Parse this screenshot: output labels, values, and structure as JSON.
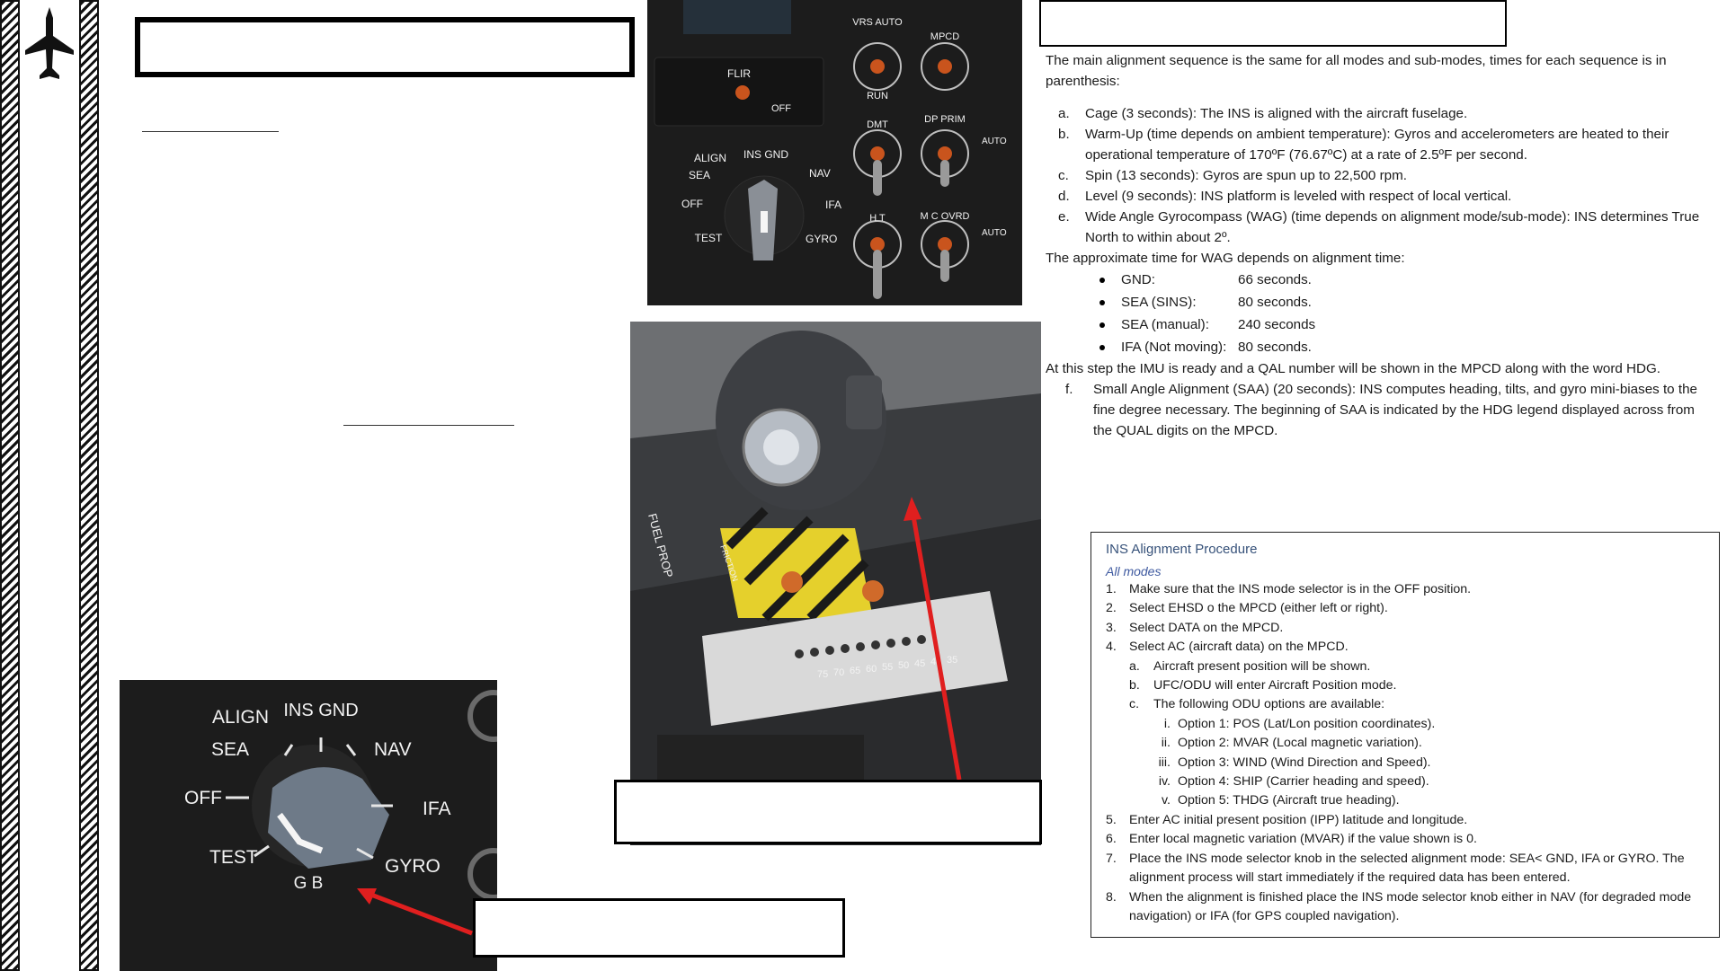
{
  "intro": "The main alignment sequence is the same for all modes and sub-modes, times for each sequence is in parenthesis:",
  "steps": [
    {
      "marker": "a.",
      "text": "Cage (3 seconds): The INS is aligned with the aircraft fuselage."
    },
    {
      "marker": "b.",
      "text": "Warm-Up (time depends on ambient temperature): Gyros and accelerometers are heated to their operational temperature of 170ºF (76.67ºC) at a rate of 2.5ºF per second."
    },
    {
      "marker": "c.",
      "text": "Spin (13 seconds): Gyros are spun up to 22,500 rpm."
    },
    {
      "marker": "d.",
      "text": "Level (9 seconds): INS platform is leveled with respect of local vertical."
    },
    {
      "marker": "e.",
      "text": "Wide Angle Gyrocompass (WAG) (time depends on alignment mode/sub-mode): INS determines True North to within about 2º."
    }
  ],
  "wag_note": "The approximate time for WAG depends on alignment time:",
  "wag_times": [
    {
      "mode": "GND:",
      "time": "66 seconds."
    },
    {
      "mode": "SEA (SINS):",
      "time": "80 seconds."
    },
    {
      "mode": "SEA (manual):",
      "time": "240 seconds"
    },
    {
      "mode": "IFA (Not moving):",
      "time": "80 seconds."
    }
  ],
  "ready_note": "At this step the IMU is ready and a QAL number will be shown in the MPCD along with the word HDG.",
  "step_f": {
    "marker": "f.",
    "text": "Small Angle Alignment (SAA) (20 seconds): INS computes heading, tilts, and gyro mini-biases to the fine degree necessary. The beginning of SAA is indicated by the HDG legend displayed across from the QUAL digits on the MPCD."
  },
  "procedure": {
    "title": "INS Alignment Procedure",
    "subtitle": "All modes",
    "items": [
      {
        "level": 1,
        "marker": "1.",
        "text": "Make sure that the INS mode selector is in the OFF position."
      },
      {
        "level": 1,
        "marker": "2.",
        "text": "Select EHSD o the MPCD (either left or right)."
      },
      {
        "level": 1,
        "marker": "3.",
        "text": "Select DATA on the MPCD."
      },
      {
        "level": 1,
        "marker": "4.",
        "text": "Select AC (aircraft data) on the MPCD."
      },
      {
        "level": 2,
        "marker": "a.",
        "text": "Aircraft present position will be shown."
      },
      {
        "level": 2,
        "marker": "b.",
        "text": "UFC/ODU will enter Aircraft Position mode."
      },
      {
        "level": 2,
        "marker": "c.",
        "text": "The following ODU options are available:"
      },
      {
        "level": 3,
        "marker": "i.",
        "text": "Option 1: POS (Lat/Lon position coordinates)."
      },
      {
        "level": 3,
        "marker": "ii.",
        "text": "Option 2: MVAR (Local magnetic variation)."
      },
      {
        "level": 3,
        "marker": "iii.",
        "text": "Option 3: WIND (Wind Direction and Speed)."
      },
      {
        "level": 3,
        "marker": "iv.",
        "text": "Option 4: SHIP (Carrier heading and speed)."
      },
      {
        "level": 3,
        "marker": "v.",
        "text": "Option 5: THDG (Aircraft true heading)."
      },
      {
        "level": 1,
        "marker": "5.",
        "text": "Enter AC initial present position (IPP) latitude and longitude."
      },
      {
        "level": 1,
        "marker": "6.",
        "text": "Enter local magnetic variation (MVAR) if the value shown is 0."
      },
      {
        "level": 1,
        "marker": "7.",
        "text": "Place the INS mode selector knob in the selected alignment mode: SEA< GND, IFA or GYRO. The alignment process will start immediately if the required data has been entered."
      },
      {
        "level": 1,
        "marker": "8.",
        "text": "When the alignment is finished place the INS mode selector knob either in NAV (for degraded mode navigation) or IFA (for GPS coupled navigation)."
      }
    ]
  },
  "panel_labels": {
    "vrs_auto": "VRS AUTO",
    "mpcd": "MPCD",
    "run": "RUN",
    "flir": "FLIR",
    "off": "OFF",
    "dmt": "DMT",
    "dp_prim": "DP PRIM",
    "auto": "AUTO",
    "ins_gnd": "INS GND",
    "align": "ALIGN",
    "sea": "SEA",
    "nav": "NAV",
    "ifa": "IFA",
    "test": "TEST",
    "gyro": "GYRO",
    "ht": "H T",
    "mc_ovrd": "M C OVRD",
    "gb": "G B"
  },
  "throttle_labels": {
    "fuel_prop": "FUEL PROP",
    "friction": "FRICTION",
    "scale": [
      "75",
      "70",
      "65",
      "60",
      "55",
      "50",
      "45",
      "40",
      "35"
    ]
  },
  "colors": {
    "panel": "#1c1c1c",
    "hatch": "#111111",
    "arrow": "#e01f1f",
    "proc_title": "#37527a"
  }
}
